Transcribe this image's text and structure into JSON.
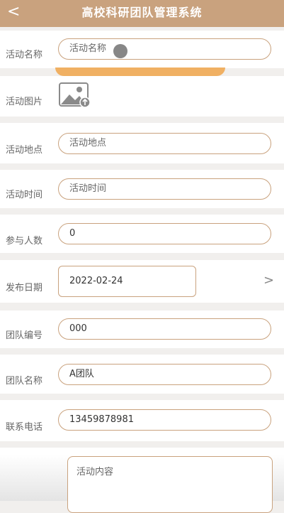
{
  "header": {
    "back": "<",
    "title": "高校科研团队管理系统"
  },
  "form": {
    "activity_name": {
      "label": "活动名称",
      "placeholder": "活动名称"
    },
    "activity_image": {
      "label": "活动图片"
    },
    "activity_place": {
      "label": "活动地点",
      "placeholder": "活动地点"
    },
    "activity_time": {
      "label": "活动时间",
      "placeholder": "活动时间"
    },
    "participants": {
      "label": "参与人数",
      "value": "0"
    },
    "publish_date": {
      "label": "发布日期",
      "value": "2022-02-24",
      "chevron": ">"
    },
    "team_no": {
      "label": "团队编号",
      "value": "000"
    },
    "team_name": {
      "label": "团队名称",
      "value": "A团队"
    },
    "phone": {
      "label": "联系电话",
      "value": "13459878981"
    },
    "content": {
      "placeholder": "活动内容"
    }
  },
  "colors": {
    "header": "#c9a27e",
    "border": "#c9a27e",
    "arc": "#f0b063"
  }
}
